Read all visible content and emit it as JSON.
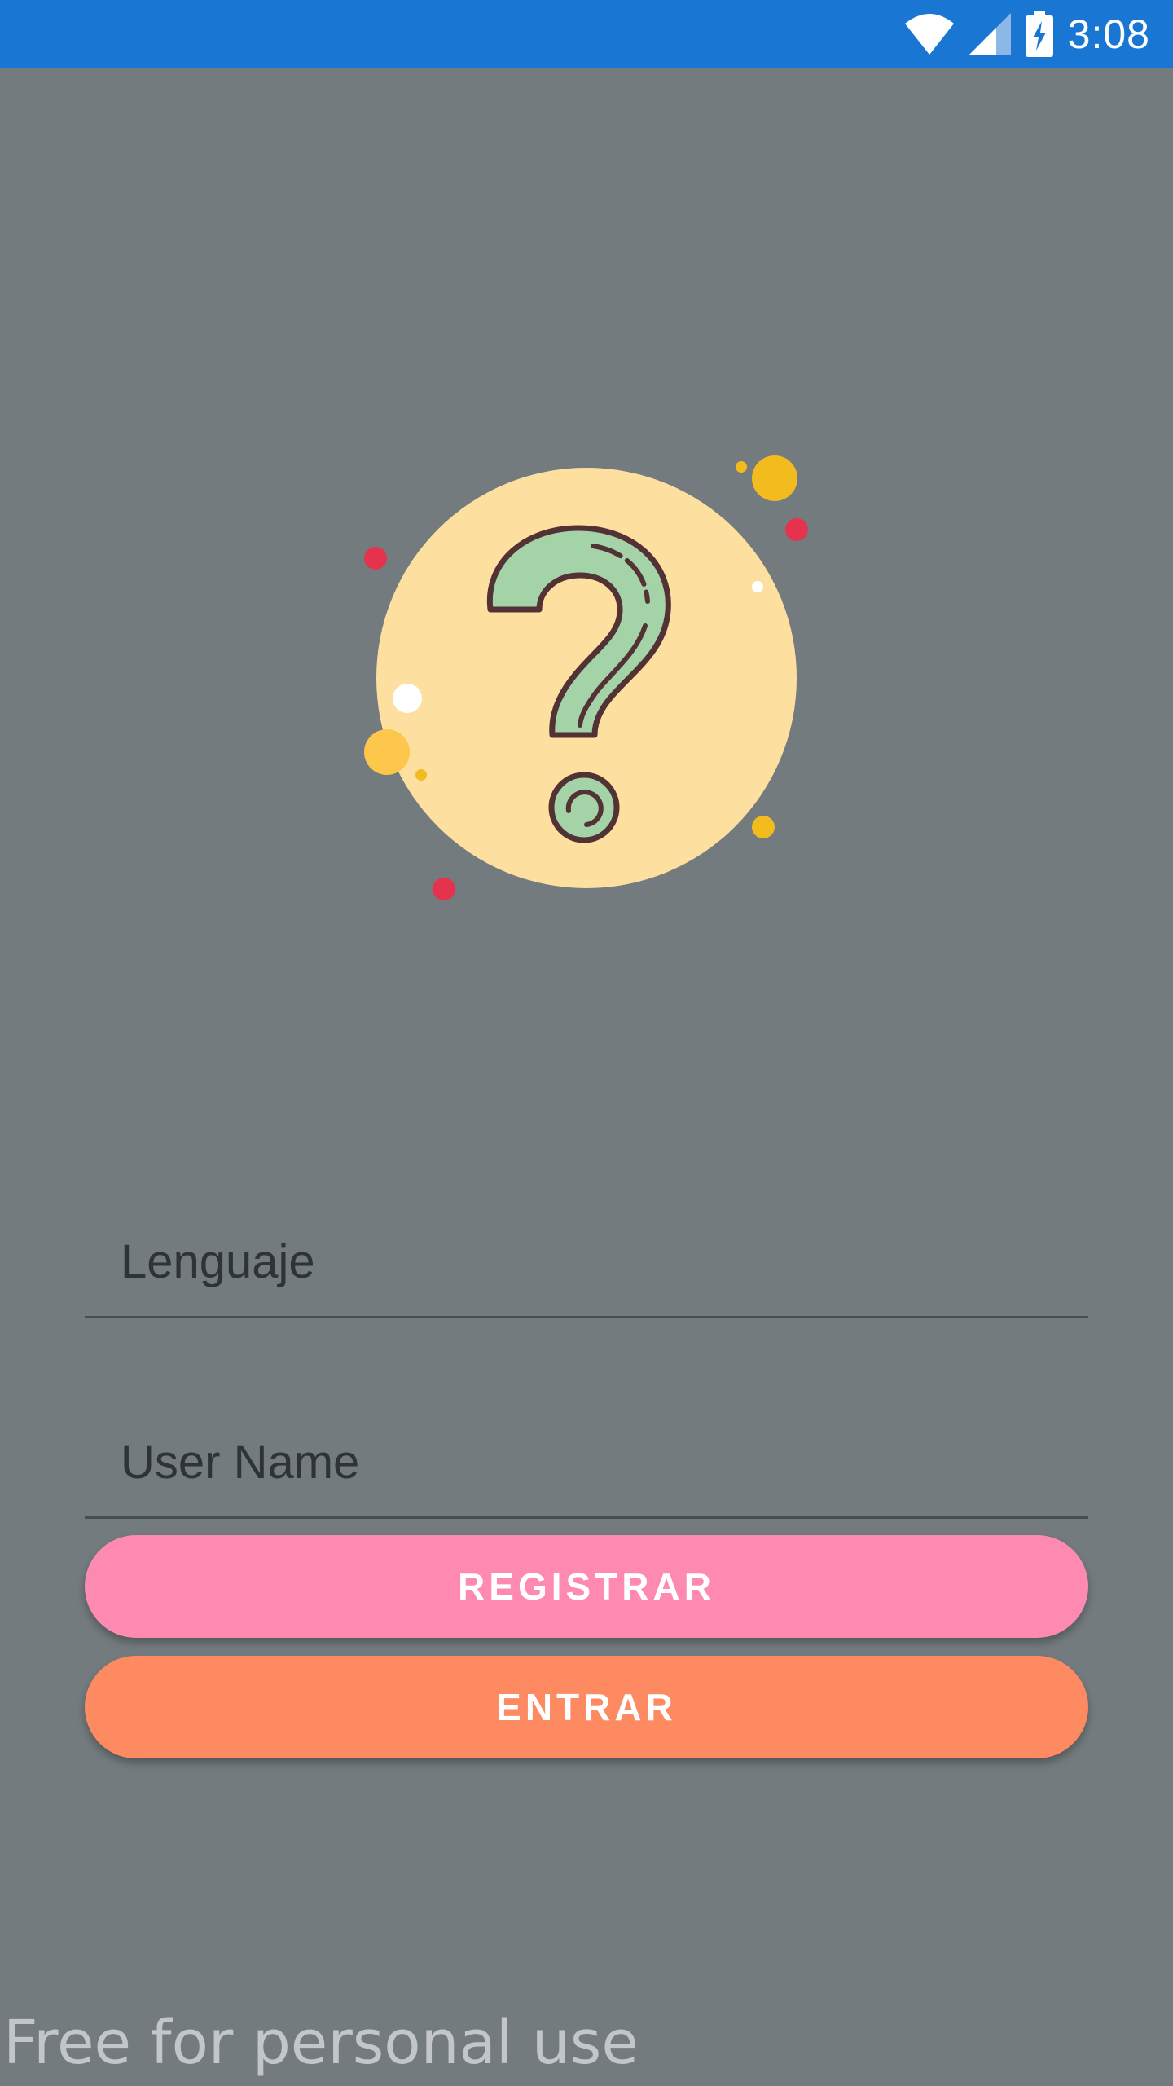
{
  "status_bar": {
    "time": "3:08",
    "background": "#1976d2",
    "icons": [
      "wifi-icon",
      "cell-signal-icon",
      "battery-charging-icon"
    ]
  },
  "illustration": {
    "icon": "question-mark-icon",
    "circle_color": "#fde09f",
    "glyph_color": "#a3d3a6"
  },
  "form": {
    "language_field": {
      "placeholder": "Lenguaje",
      "value": ""
    },
    "username_field": {
      "placeholder": "User Name",
      "value": ""
    },
    "register_button_label": "REGISTRAR",
    "enter_button_label": "ENTRAR",
    "register_color": "#fe8ab1",
    "enter_color": "#fe8a61"
  },
  "watermark": "Free for personal use",
  "background": "#737b7e"
}
